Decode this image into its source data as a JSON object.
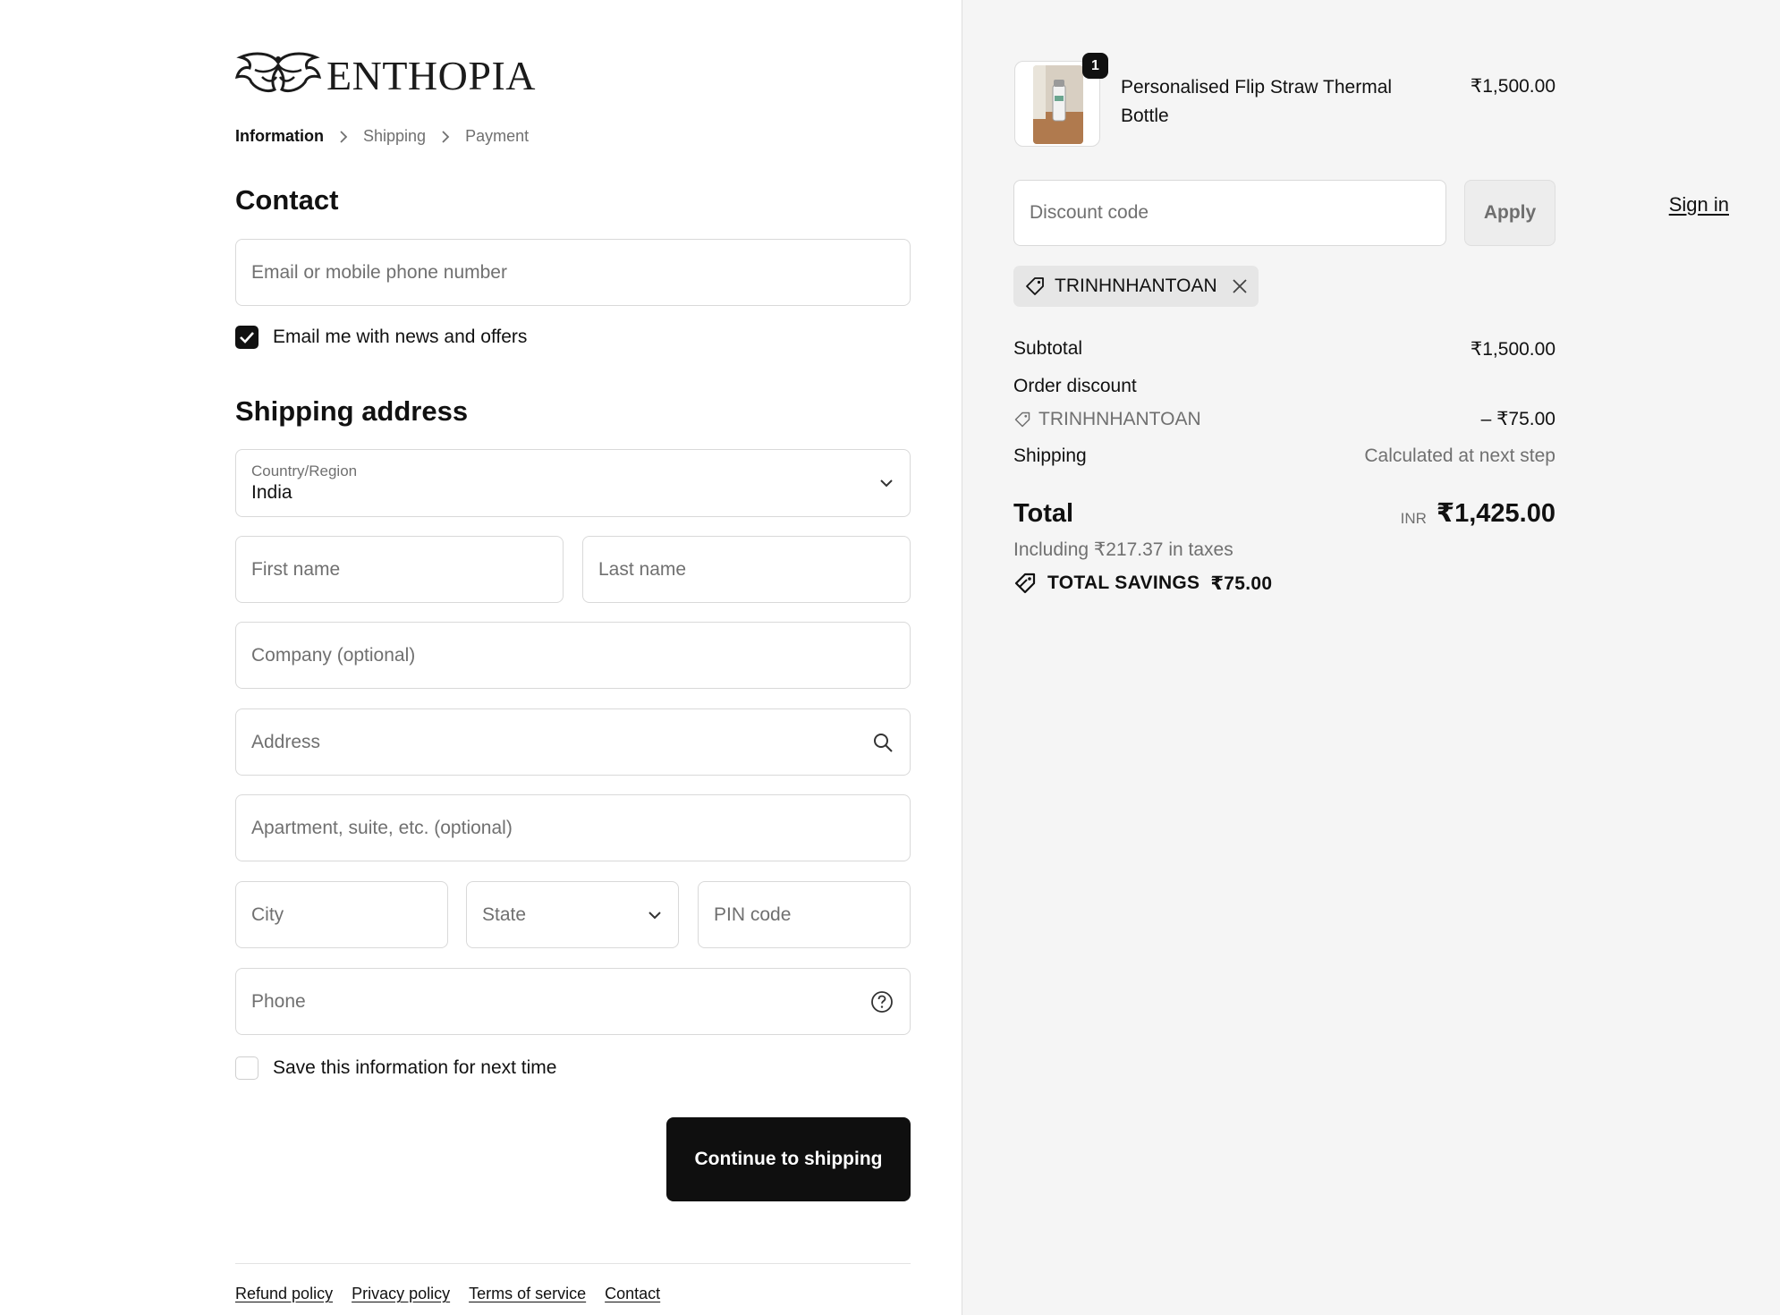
{
  "brand": {
    "name": "ENTHOPIA"
  },
  "breadcrumb": [
    {
      "label": "Information",
      "active": true
    },
    {
      "label": "Shipping",
      "active": false
    },
    {
      "label": "Payment",
      "active": false
    }
  ],
  "contact": {
    "title": "Contact",
    "signin_label": "Sign in",
    "email_placeholder": "Email or mobile phone number",
    "email_value": "",
    "news_label": "Email me with news and offers",
    "news_checked": true
  },
  "shipping_address": {
    "title": "Shipping address",
    "country_label": "Country/Region",
    "country_value": "India",
    "first_name_placeholder": "First name",
    "last_name_placeholder": "Last name",
    "company_placeholder": "Company (optional)",
    "address_placeholder": "Address",
    "apartment_placeholder": "Apartment, suite, etc. (optional)",
    "city_placeholder": "City",
    "state_placeholder": "State",
    "pin_placeholder": "PIN code",
    "phone_placeholder": "Phone",
    "save_info_label": "Save this information for next time",
    "save_info_checked": false
  },
  "actions": {
    "continue_label": "Continue to shipping"
  },
  "footer": {
    "links": [
      "Refund policy",
      "Privacy policy",
      "Terms of service",
      "Contact"
    ]
  },
  "order": {
    "item": {
      "name": "Personalised Flip Straw Thermal Bottle",
      "price": "₹1,500.00",
      "quantity": "1"
    },
    "discount_placeholder": "Discount code",
    "apply_label": "Apply",
    "applied_code": "TRINHNHANTOAN",
    "subtotal_label": "Subtotal",
    "subtotal_value": "₹1,500.00",
    "order_discount_label": "Order discount",
    "order_discount_code": "TRINHNHANTOAN",
    "order_discount_value": "– ₹75.00",
    "shipping_label": "Shipping",
    "shipping_value": "Calculated at next step",
    "total_label": "Total",
    "currency": "INR",
    "total_value": "₹1,425.00",
    "tax_note": "Including ₹217.37 in taxes",
    "savings_label": "TOTAL SAVINGS",
    "savings_value": "₹75.00"
  },
  "colors": {
    "primary_button": "#0f0f0f",
    "summary_background": "#f5f5f5",
    "muted_text": "#707070"
  }
}
